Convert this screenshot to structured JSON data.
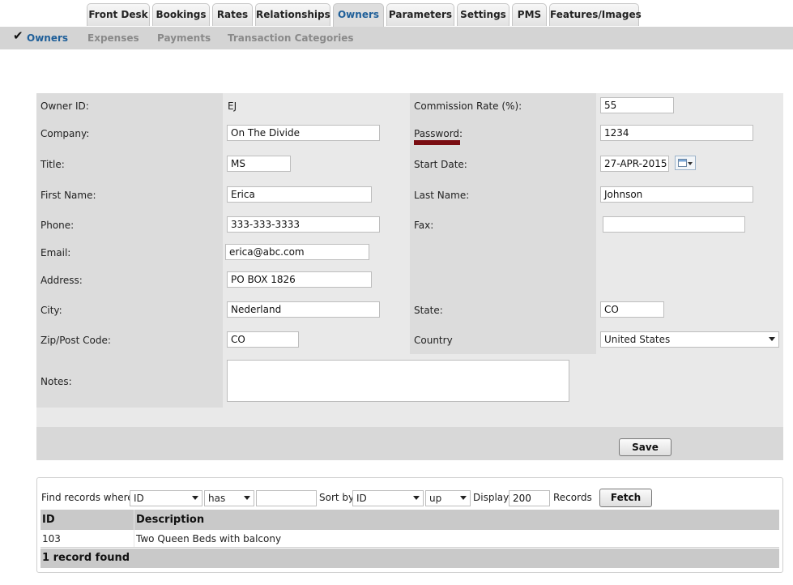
{
  "tabs": [
    "Front Desk",
    "Bookings",
    "Rates",
    "Relationships",
    "Owners",
    "Parameters",
    "Settings",
    "PMS",
    "Features/Images"
  ],
  "active_tab": "Owners",
  "subnav": [
    "Owners",
    "Expenses",
    "Payments",
    "Transaction Categories"
  ],
  "form": {
    "owner_id_label": "Owner ID:",
    "owner_id": "EJ",
    "commission_label": "Commission Rate (%):",
    "commission": "55",
    "company_label": "Company:",
    "company": "On The Divide",
    "password_label": "Password:",
    "password": "1234",
    "title_label": "Title:",
    "title": "MS",
    "start_date_label": "Start Date:",
    "start_date": "27-APR-2015",
    "first_name_label": "First Name:",
    "first_name": "Erica",
    "last_name_label": "Last Name:",
    "last_name": "Johnson",
    "phone_label": "Phone:",
    "phone": "333-333-3333",
    "fax_label": "Fax:",
    "fax": "",
    "email_label": "Email:",
    "email": "erica@abc.com",
    "address_label": "Address:",
    "address": "PO BOX 1826",
    "city_label": "City:",
    "city": "Nederland",
    "state_label": "State:",
    "state": "CO",
    "zip_label": "Zip/Post Code:",
    "zip": "CO",
    "country_label": "Country",
    "country": "United States",
    "notes_label": "Notes:",
    "notes": "",
    "save_label": "Save"
  },
  "find": {
    "find_label": "Find records where",
    "field": "ID",
    "op": "has",
    "value": "",
    "sort_label": "Sort by",
    "sort_field": "ID",
    "sort_dir": "up",
    "display_label": "Display",
    "display": "200",
    "records_label": "Records",
    "fetch_label": "Fetch"
  },
  "grid": {
    "columns": [
      "ID",
      "Description"
    ],
    "rows": [
      {
        "id": "103",
        "description": "Two Queen Beds with balcony"
      }
    ],
    "footer": "1 record found"
  },
  "colors": {
    "accent": "#1f5f99",
    "password_strength": "#7a0d12"
  }
}
